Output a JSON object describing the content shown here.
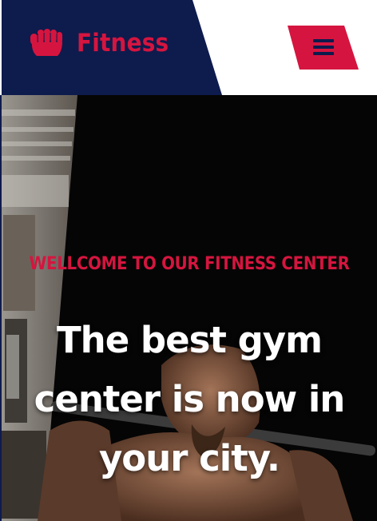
{
  "header": {
    "brand": {
      "name": "Fitness",
      "icon": "fist-icon"
    },
    "menu": {
      "icon": "hamburger-menu-icon"
    }
  },
  "hero": {
    "eyebrow": "WELLCOME TO OUR FITNESS CENTER",
    "headline": [
      "The best gym",
      "center is now in",
      "your city."
    ],
    "background": "gym-athlete-barbell-photo"
  },
  "colors": {
    "navy": "#0e1b4d",
    "accent": "#d5153f",
    "hero_text": "#ffffff",
    "hero_bg": "#050505"
  }
}
